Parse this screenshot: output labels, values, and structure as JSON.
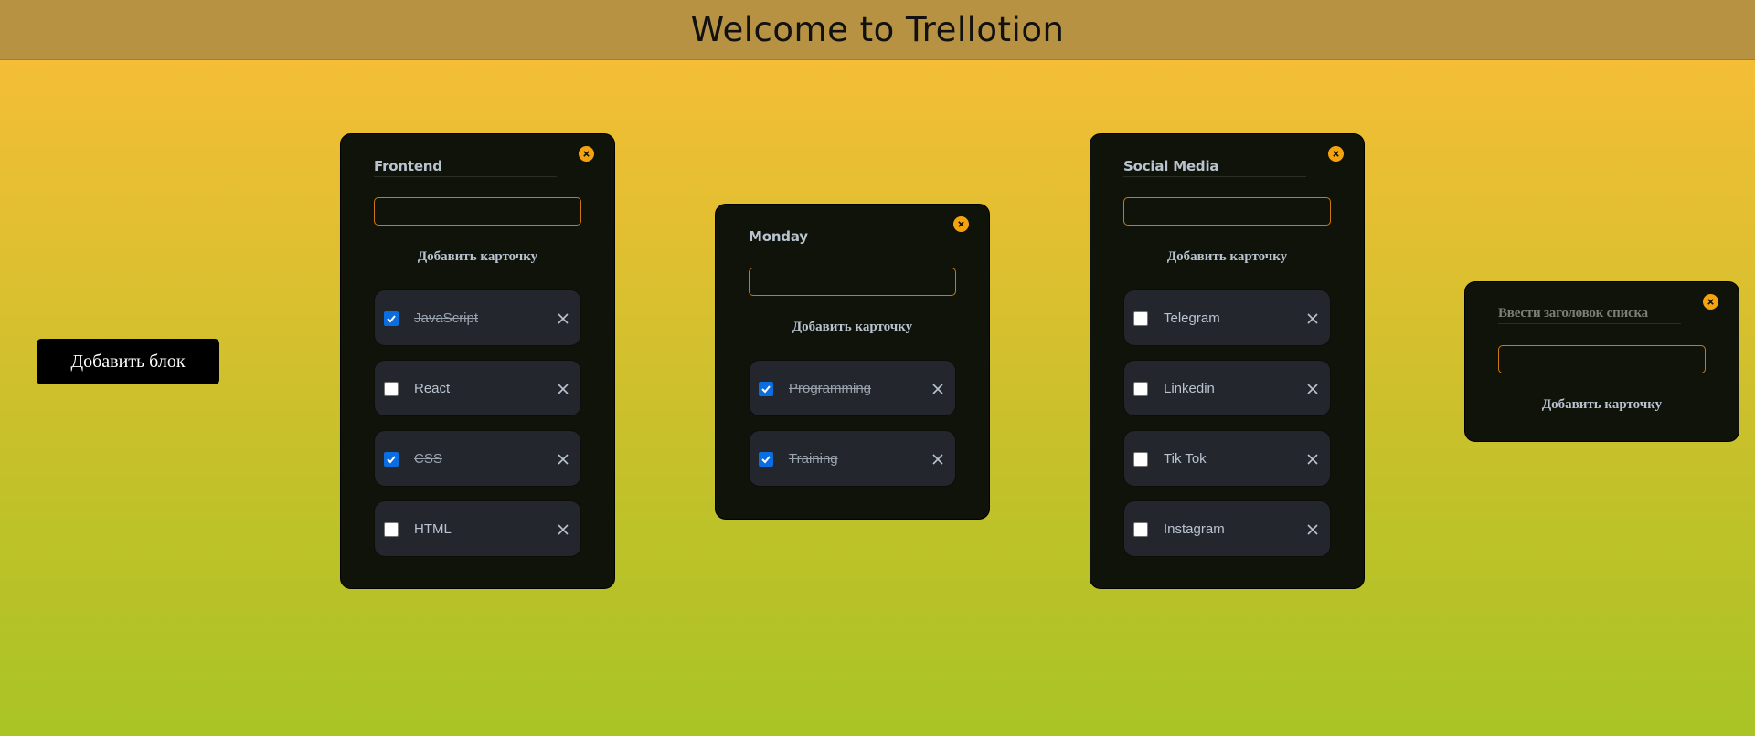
{
  "app": {
    "title": "Welcome to Trellotion"
  },
  "toolbar": {
    "add_block_label": "Добавить блок"
  },
  "colors": {
    "accent": "#f4a30f",
    "panel": "#10130a",
    "card": "#23272d",
    "header": "#b69242",
    "checked": "#0b6ee0"
  },
  "icons": {
    "close": "close-circle-icon",
    "delete": "x-icon",
    "check": "checkmark-icon"
  },
  "lists": [
    {
      "title": "Frontend",
      "add_card_label": "Добавить карточку",
      "cards": [
        {
          "label": "JavaScript",
          "checked": true
        },
        {
          "label": "React",
          "checked": false
        },
        {
          "label": "CSS",
          "checked": true
        },
        {
          "label": "HTML",
          "checked": false
        }
      ]
    },
    {
      "title": "Monday",
      "add_card_label": "Добавить карточку",
      "cards": [
        {
          "label": "Programming",
          "checked": true
        },
        {
          "label": "Training",
          "checked": true
        }
      ]
    },
    {
      "title": "Social Media",
      "add_card_label": "Добавить карточку",
      "cards": [
        {
          "label": "Telegram",
          "checked": false
        },
        {
          "label": "Linkedin",
          "checked": false
        },
        {
          "label": "Tik Tok",
          "checked": false
        },
        {
          "label": "Instagram",
          "checked": false
        }
      ]
    },
    {
      "title_placeholder": "Ввести заголовок списка",
      "add_card_label": "Добавить карточку",
      "cards": []
    }
  ]
}
